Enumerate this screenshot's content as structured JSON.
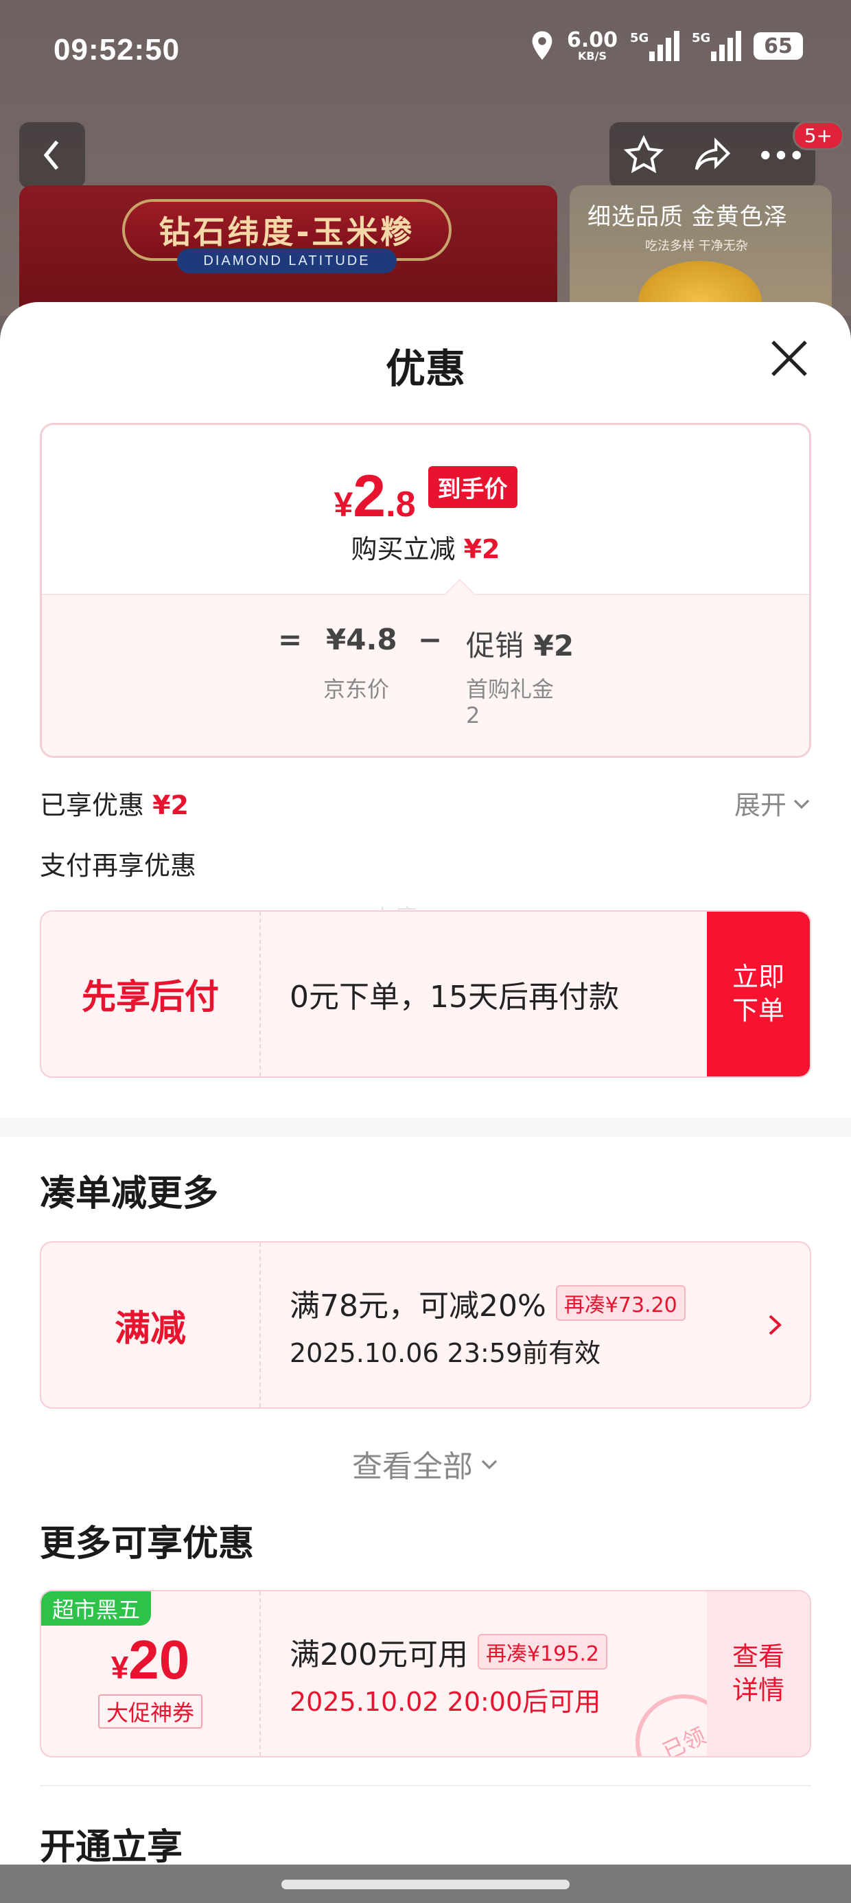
{
  "status_bar": {
    "time": "09:52:50",
    "net_speed": "6.00",
    "net_unit": "KB/S",
    "sig1_label": "5G",
    "sig2_label": "5G",
    "battery": "65"
  },
  "nav": {
    "badge": "5+"
  },
  "banner": {
    "main_title": "钻石纬度-玉米糁",
    "main_sub": "DIAMOND LATITUDE",
    "side_title": "细选品质 金黄色泽",
    "side_sub": "吃法多样 干净无杂"
  },
  "sheet": {
    "title": "优惠",
    "price": {
      "currency": "¥",
      "integer": "2",
      "decimal": ".8",
      "tag": "到手价",
      "save_label": "购买立减",
      "save_amount": "¥2",
      "eq": "=",
      "base_price": "¥4.8",
      "minus": "−",
      "promo_label": "促销",
      "promo_amount": "¥2",
      "base_desc": "京东价",
      "promo_desc": "首购礼金",
      "promo_count": "2"
    },
    "enjoyed_label": "已享优惠",
    "enjoyed_amount": "¥2",
    "expand_label": "展开",
    "pay_title": "支付再享优惠",
    "watermark": "小瘾",
    "bnpl": {
      "label": "先享后付",
      "text": "0元下单，15天后再付款",
      "btn_line1": "立即",
      "btn_line2": "下单"
    },
    "section1_title": "凑单减更多",
    "manjian": {
      "label": "满减",
      "line1": "满78元，可减20%",
      "pill": "再凑¥73.20",
      "line2": "2025.10.06 23:59前有效"
    },
    "view_all": "查看全部",
    "section2_title": "更多可享优惠",
    "coupon": {
      "corner": "超市黑五",
      "currency": "¥",
      "amount": "20",
      "type": "大促神券",
      "line1": "满200元可用",
      "pill": "再凑¥195.2",
      "line2": "2025.10.02 20:00后可用",
      "detail_line1": "查看",
      "detail_line2": "详情",
      "stamp": "已领"
    },
    "section3_title": "开通立享"
  }
}
